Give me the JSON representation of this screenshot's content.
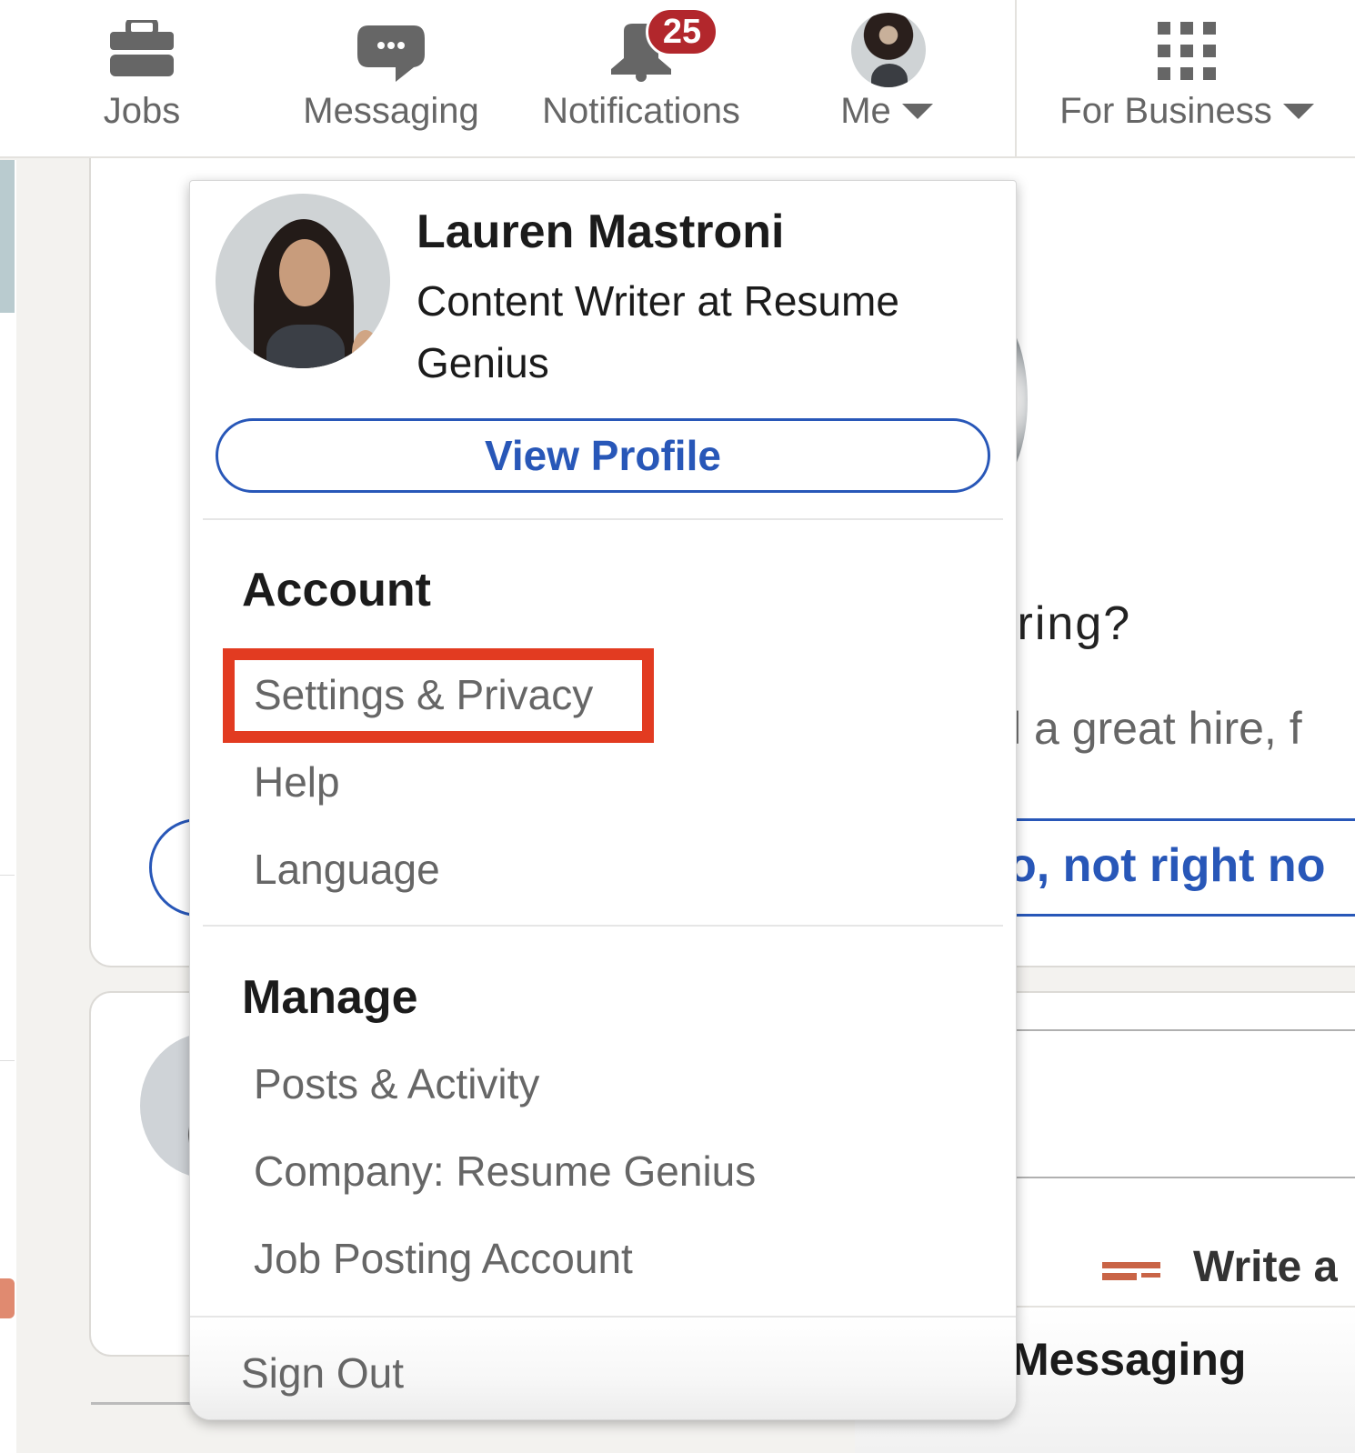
{
  "topnav": {
    "items": [
      {
        "id": "jobs",
        "label": "Jobs",
        "icon": "briefcase-icon"
      },
      {
        "id": "messaging",
        "label": "Messaging",
        "icon": "chat-bubble-icon"
      },
      {
        "id": "notifications",
        "label": "Notifications",
        "icon": "bell-icon",
        "badge": "25"
      },
      {
        "id": "me",
        "label": "Me",
        "icon": "avatar"
      },
      {
        "id": "for_business",
        "label": "For Business",
        "icon": "grid-icon"
      }
    ],
    "badge_color": "#b2272c"
  },
  "dropdown": {
    "profile": {
      "name": "Lauren Mastroni",
      "headline": "Content Writer at Resume Genius",
      "view_profile_label": "View Profile"
    },
    "sections": [
      {
        "title": "Account",
        "items": [
          "Settings & Privacy",
          "Help",
          "Language"
        ]
      },
      {
        "title": "Manage",
        "items": [
          "Posts & Activity",
          "Company: Resume Genius",
          "Job Posting Account"
        ]
      }
    ],
    "sign_out_label": "Sign Out",
    "highlighted_item": "Settings & Privacy",
    "highlight_color": "#e23b21",
    "accent_color": "#2857b8"
  },
  "background": {
    "heading_fragment": "iring?",
    "body_fragment": "l a great hire, f",
    "button_fragment": "o, not right no",
    "write_fragment": "Write a",
    "messaging_bar_title": "Messaging"
  }
}
